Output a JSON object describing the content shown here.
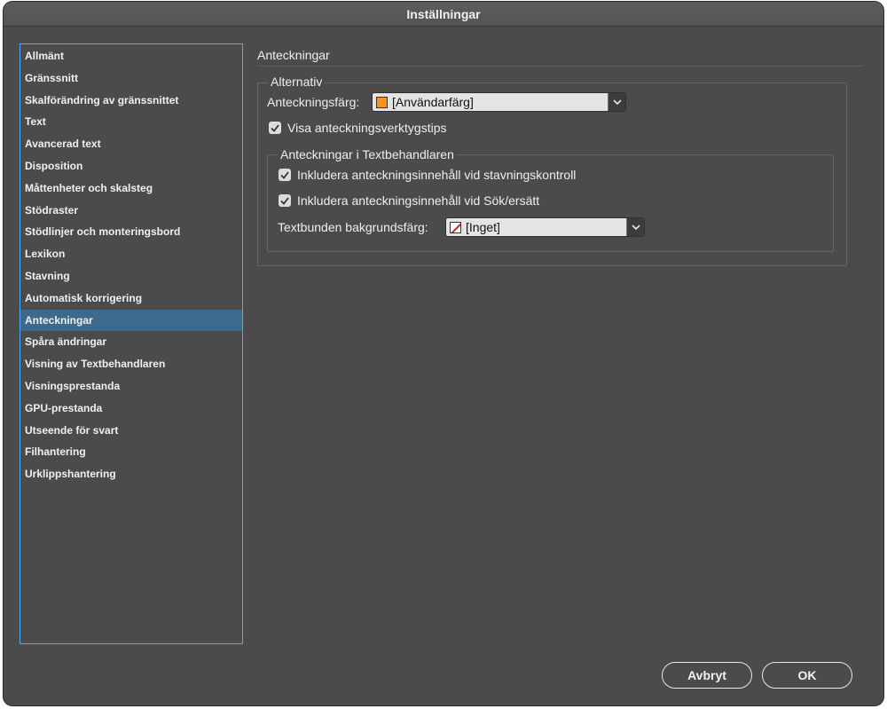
{
  "window": {
    "title": "Inställningar"
  },
  "sidebar": {
    "items": [
      {
        "label": "Allmänt"
      },
      {
        "label": "Gränssnitt"
      },
      {
        "label": "Skalförändring av gränssnittet"
      },
      {
        "label": "Text"
      },
      {
        "label": "Avancerad text"
      },
      {
        "label": "Disposition"
      },
      {
        "label": "Måttenheter och skalsteg"
      },
      {
        "label": "Stödraster"
      },
      {
        "label": "Stödlinjer och monteringsbord"
      },
      {
        "label": "Lexikon"
      },
      {
        "label": "Stavning"
      },
      {
        "label": "Automatisk korrigering"
      },
      {
        "label": "Anteckningar"
      },
      {
        "label": "Spåra ändringar"
      },
      {
        "label": "Visning av Textbehandlaren"
      },
      {
        "label": "Visningsprestanda"
      },
      {
        "label": "GPU-prestanda"
      },
      {
        "label": "Utseende för svart"
      },
      {
        "label": "Filhantering"
      },
      {
        "label": "Urklippshantering"
      }
    ],
    "selected_index": 12
  },
  "panel": {
    "title": "Anteckningar",
    "options_group": {
      "legend": "Alternativ",
      "note_color_label": "Anteckningsfärg:",
      "note_color_value": "[Användarfärg]",
      "note_color_swatch": "#f7941d",
      "show_tooltips_label": "Visa anteckningsverktygstips",
      "show_tooltips_checked": true
    },
    "story_editor_group": {
      "legend": "Anteckningar i Textbehandlaren",
      "include_spellcheck_label": "Inkludera anteckningsinnehåll vid stavningskontroll",
      "include_spellcheck_checked": true,
      "include_findreplace_label": "Inkludera anteckningsinnehåll vid Sök/ersätt",
      "include_findreplace_checked": true,
      "inline_bg_label": "Textbunden bakgrundsfärg:",
      "inline_bg_value": "[Inget]"
    }
  },
  "buttons": {
    "cancel_label": "Avbryt",
    "ok_label": "OK"
  },
  "colors": {
    "window_bg": "#4b4b4b",
    "selection": "#3d6a8c",
    "focus_border": "#4da6ff"
  }
}
